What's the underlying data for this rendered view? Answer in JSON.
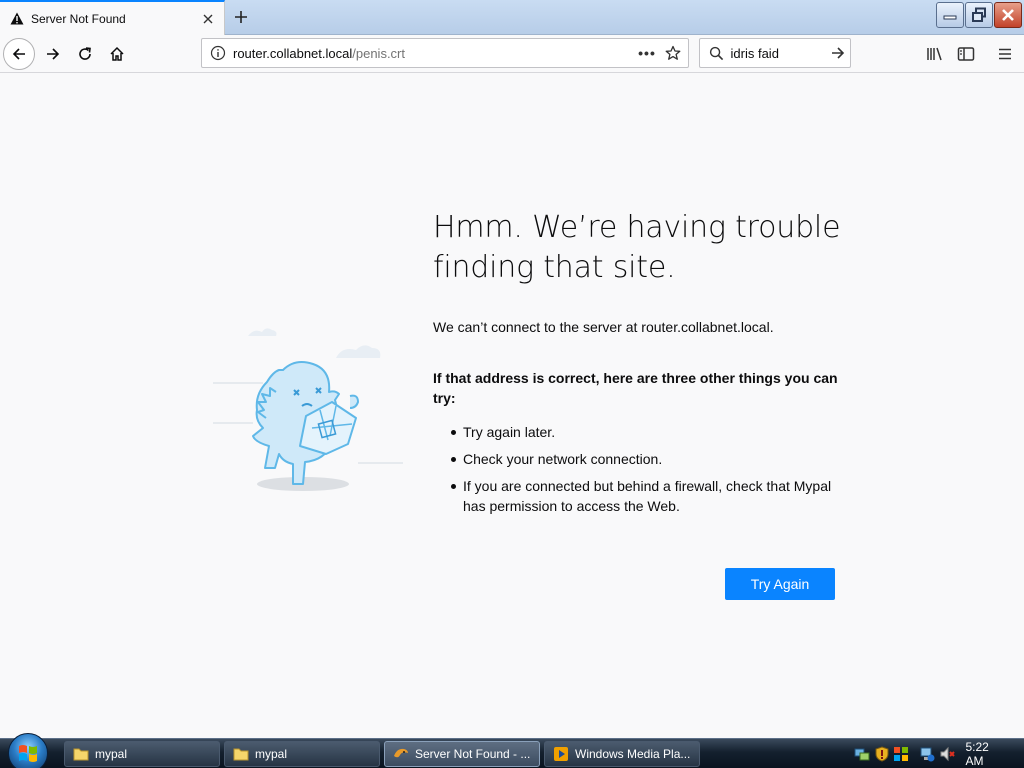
{
  "browser": {
    "tab": {
      "title": "Server Not Found"
    },
    "url": {
      "host": "router.collabnet.local",
      "path": "/penis.crt"
    },
    "search": {
      "value": "idris faid"
    }
  },
  "error_page": {
    "title": "Hmm. We’re having trouble finding that site.",
    "description": "We can’t connect to the server at router.collabnet.local.",
    "suggestions_heading": "If that address is correct, here are three other things you can try:",
    "suggestions": [
      "Try again later.",
      "Check your network connection.",
      "If you are connected but behind a firewall, check that Mypal has permission to access the Web."
    ],
    "try_again_label": "Try Again"
  },
  "taskbar": {
    "items": [
      {
        "label": "mypal",
        "icon": "folder-icon"
      },
      {
        "label": "mypal",
        "icon": "folder-icon"
      },
      {
        "label": "Server Not Found - ...",
        "icon": "mypal-icon",
        "active": true
      },
      {
        "label": "Windows Media Pla...",
        "icon": "media-player-icon"
      }
    ],
    "clock": "5:22 AM"
  },
  "colors": {
    "accent": "#0a84ff",
    "background": "#f9f9fa",
    "text": "#0c0c0d"
  }
}
